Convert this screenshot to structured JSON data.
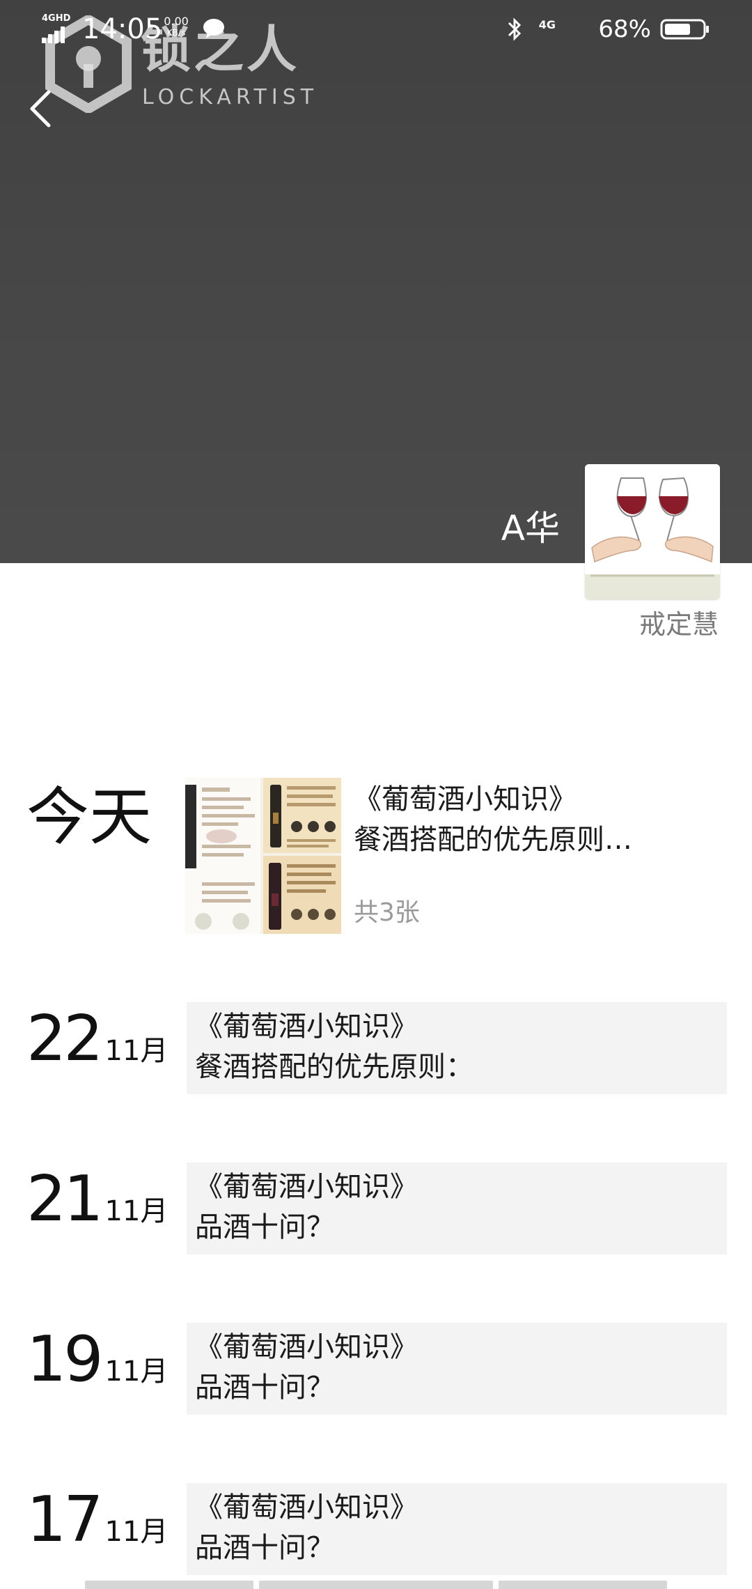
{
  "status_bar": {
    "network_label": "4GHD",
    "time": "14:05",
    "net_speed_value": "0.00",
    "net_speed_unit": "KB/s",
    "cellular": "4G",
    "battery_pct": "68%"
  },
  "watermark": {
    "name_cn": "锁之人",
    "name_en": "LOCKARTIST"
  },
  "cover": {
    "user_name": "A华",
    "signature": "戒定慧"
  },
  "today": {
    "date_label": "今天",
    "title": "《葡萄酒小知识》",
    "subtitle": "餐酒搭配的优先原则…",
    "photo_count": "共3张"
  },
  "posts": [
    {
      "day": "22",
      "month": "11月",
      "title": "《葡萄酒小知识》",
      "subtitle": "餐酒搭配的优先原则："
    },
    {
      "day": "21",
      "month": "11月",
      "title": "《葡萄酒小知识》",
      "subtitle": "品酒十问？"
    },
    {
      "day": "19",
      "month": "11月",
      "title": "《葡萄酒小知识》",
      "subtitle": "品酒十问？"
    },
    {
      "day": "17",
      "month": "11月",
      "title": "《葡萄酒小知识》",
      "subtitle": "品酒十问？"
    }
  ],
  "icons": {
    "back": "chevron-left-icon",
    "bluetooth": "bluetooth-icon",
    "battery": "battery-icon",
    "signal": "signal-icon",
    "chat": "chat-bubble-icon"
  },
  "colors": {
    "cover_bg": "#444444",
    "card_bg": "#f3f3f3",
    "muted_text": "#9a9a9a"
  }
}
